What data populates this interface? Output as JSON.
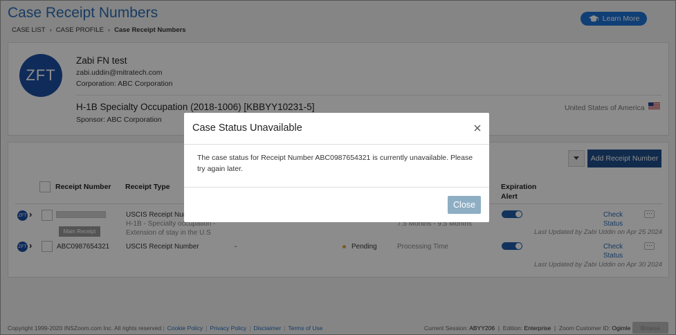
{
  "header": {
    "title": "Case Receipt Numbers",
    "learn_more": "Learn More",
    "breadcrumb": [
      "CASE LIST",
      "CASE PROFILE",
      "Case Receipt Numbers"
    ]
  },
  "profile": {
    "initials": "ZFT",
    "name": "Zabi FN test",
    "email": "zabi.uddin@mitratech.com",
    "corporation": "Corporation: ABC Corporation",
    "case_title": "H-1B Specialty Occupation (2018-1006) [KBBYY10231-5]",
    "sponsor": "Sponsor: ABC Corporation",
    "country": "United States of America"
  },
  "table": {
    "add_button": "Add Receipt Number",
    "headers": {
      "receipt_number": "Receipt Number",
      "receipt_type": "Receipt Type",
      "expiration_alert": [
        "Expiration",
        "Alert"
      ]
    },
    "rows": [
      {
        "icon": "ZFT",
        "main_receipt": "Main Receipt",
        "type": "USCIS Receipt Number",
        "type_sub1": "H-1B - Specialty occupation -",
        "type_sub2": "Extension of stay in the U.S",
        "processing": "7.5 Months - 9.5 Months",
        "check": [
          "Check",
          "Status"
        ],
        "updated": "Last Updated by Zabi Uddin on Apr 25 2024"
      },
      {
        "icon": "ZFT",
        "receipt": "ABC0987654321",
        "type": "USCIS Receipt Number",
        "dash": "-",
        "status": "Pending",
        "processing": "Processing Time",
        "check": [
          "Check",
          "Status"
        ],
        "updated": "Last Updated by Zabi Uddin on Apr 30 2024"
      }
    ]
  },
  "footer": {
    "copyright": "Copyright 1999-2020 INSZoom.com Inc. All rights reserved",
    "links": [
      "Cookie Policy",
      "Privacy Policy",
      "Disclaimer",
      "Terms of Use"
    ],
    "session_label": "Current Session:",
    "session_value": "ABYY206",
    "edition_label": "Edition:",
    "edition_value": "Enterprise",
    "zoom_label": "Zoom Customer ID:",
    "zoom_value": "Ogimle",
    "browse": "Browse"
  },
  "modal": {
    "title": "Case Status Unavailable",
    "body": "The case status for Receipt Number ABC0987654321 is currently unavailable. Please try again later.",
    "close_button": "Close"
  },
  "colors": {
    "accent": "#2a6db5",
    "primary_button": "#1f4f8c",
    "avatar": "#1d4fa4",
    "pending": "#e8a33c",
    "modal_button": "#8eaec4"
  }
}
